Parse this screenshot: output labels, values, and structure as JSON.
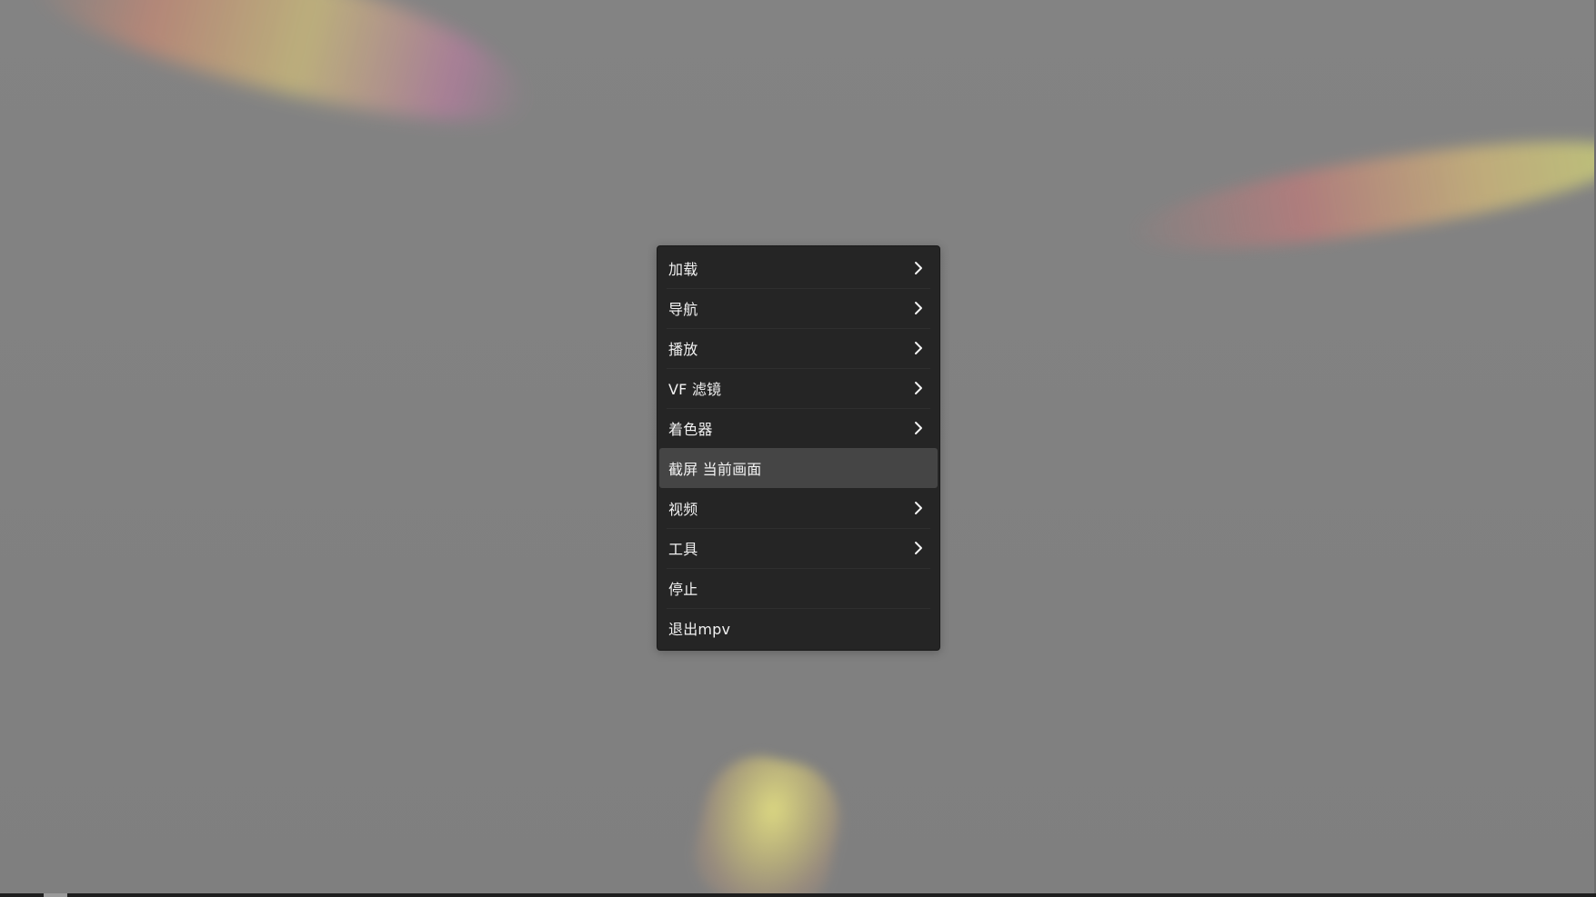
{
  "colors": {
    "background": "#808080",
    "menu_background": "#252525",
    "menu_highlight": "#454545",
    "menu_text": "#f2f2f2"
  },
  "menu": {
    "items": [
      {
        "label": "加载",
        "submenu": true,
        "icon": "chevron-right-icon"
      },
      {
        "label": "导航",
        "submenu": true,
        "icon": "chevron-right-icon"
      },
      {
        "label": "播放",
        "submenu": true,
        "icon": "chevron-right-icon"
      },
      {
        "label": "VF 滤镜",
        "submenu": true,
        "icon": "chevron-right-icon"
      },
      {
        "label": "着色器",
        "submenu": true,
        "icon": "chevron-right-icon"
      },
      {
        "label": "截屏 当前画面",
        "submenu": false,
        "highlighted": true
      },
      {
        "label": "视频",
        "submenu": true,
        "icon": "chevron-right-icon"
      },
      {
        "label": "工具",
        "submenu": true,
        "icon": "chevron-right-icon"
      },
      {
        "label": "停止",
        "submenu": false
      },
      {
        "label": "退出mpv",
        "submenu": false
      }
    ]
  }
}
